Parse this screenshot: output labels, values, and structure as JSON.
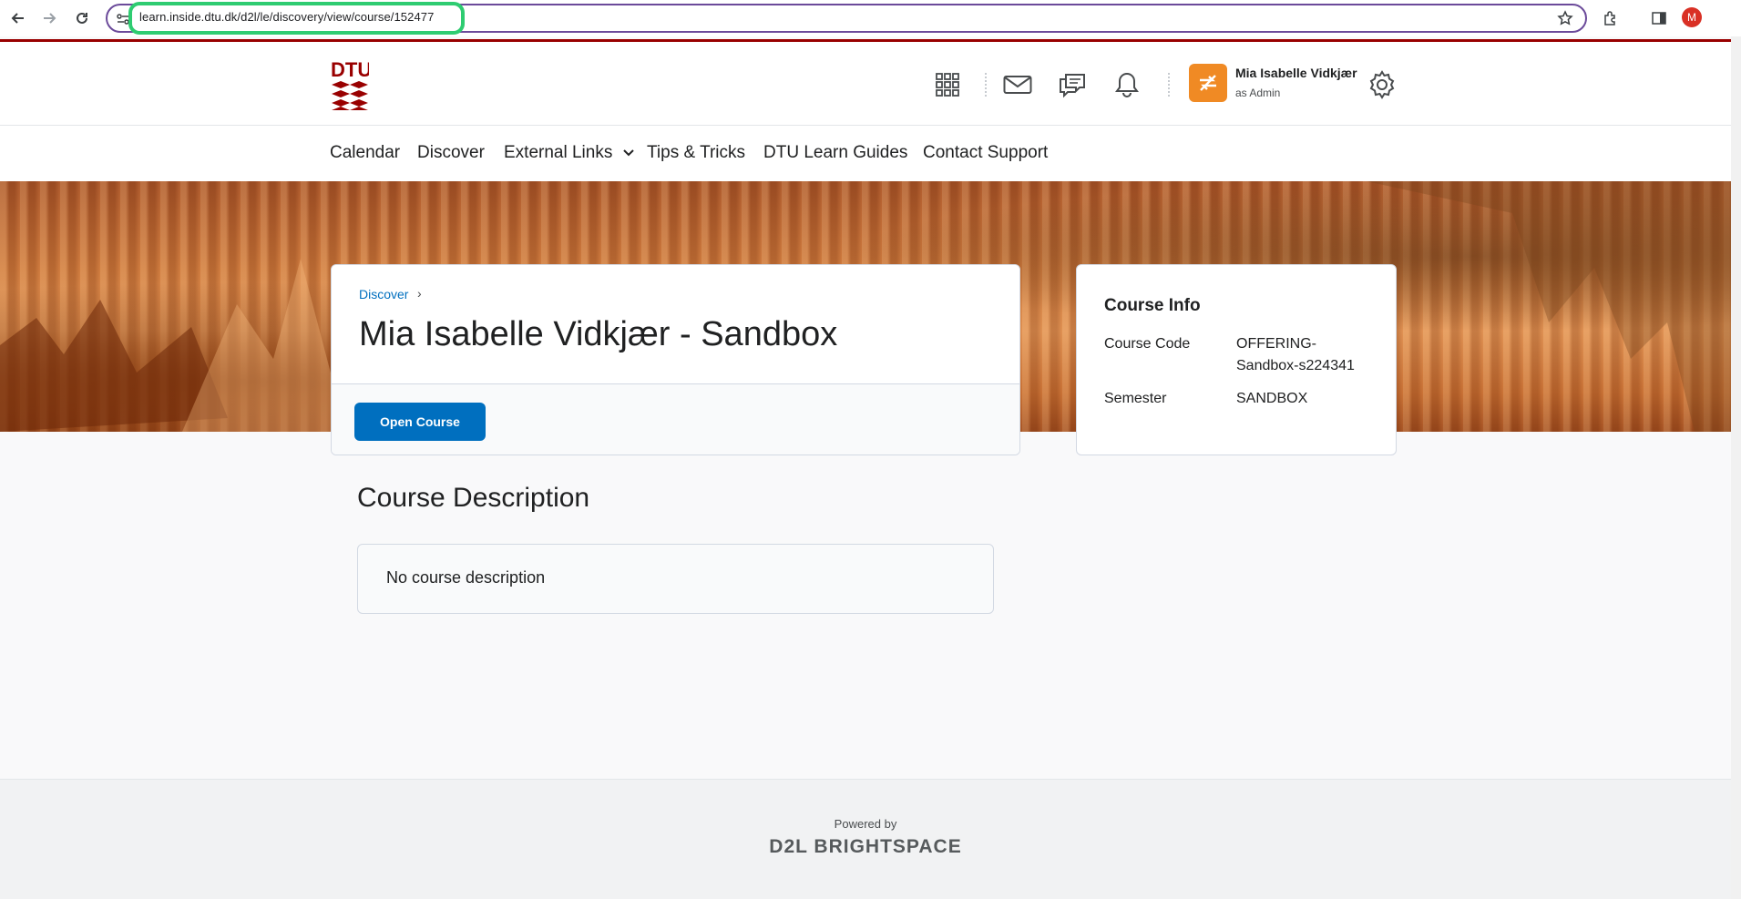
{
  "browser": {
    "url": "learn.inside.dtu.dk/d2l/le/discovery/view/course/152477",
    "profile_initial": "M"
  },
  "header": {
    "logo_text": "DTU",
    "user_name": "Mia Isabelle Vidkjær",
    "user_role": "as Admin",
    "icons": [
      "apps-grid-icon",
      "mail-icon",
      "chat-icon",
      "bell-icon",
      "role-switch-icon",
      "gear-icon"
    ]
  },
  "nav": {
    "items": [
      "Calendar",
      "Discover",
      "External Links",
      "Tips & Tricks",
      "DTU Learn Guides",
      "Contact Support"
    ]
  },
  "course": {
    "breadcrumb": "Discover",
    "breadcrumb_sep": "›",
    "title": "Mia Isabelle Vidkjær - Sandbox",
    "open_button": "Open Course"
  },
  "info": {
    "title": "Course Info",
    "code_label": "Course Code",
    "code_value_line1": "OFFERING-",
    "code_value_line2": "Sandbox-s224341",
    "semester_label": "Semester",
    "semester_value": "SANDBOX"
  },
  "description": {
    "heading": "Course Description",
    "text": "No course description"
  },
  "footer": {
    "powered_by": "Powered by",
    "brand": "D2L BRIGHTSPACE"
  },
  "colors": {
    "dtu_red": "#990000",
    "link_blue": "#006fbf",
    "role_orange": "#f08a24"
  }
}
